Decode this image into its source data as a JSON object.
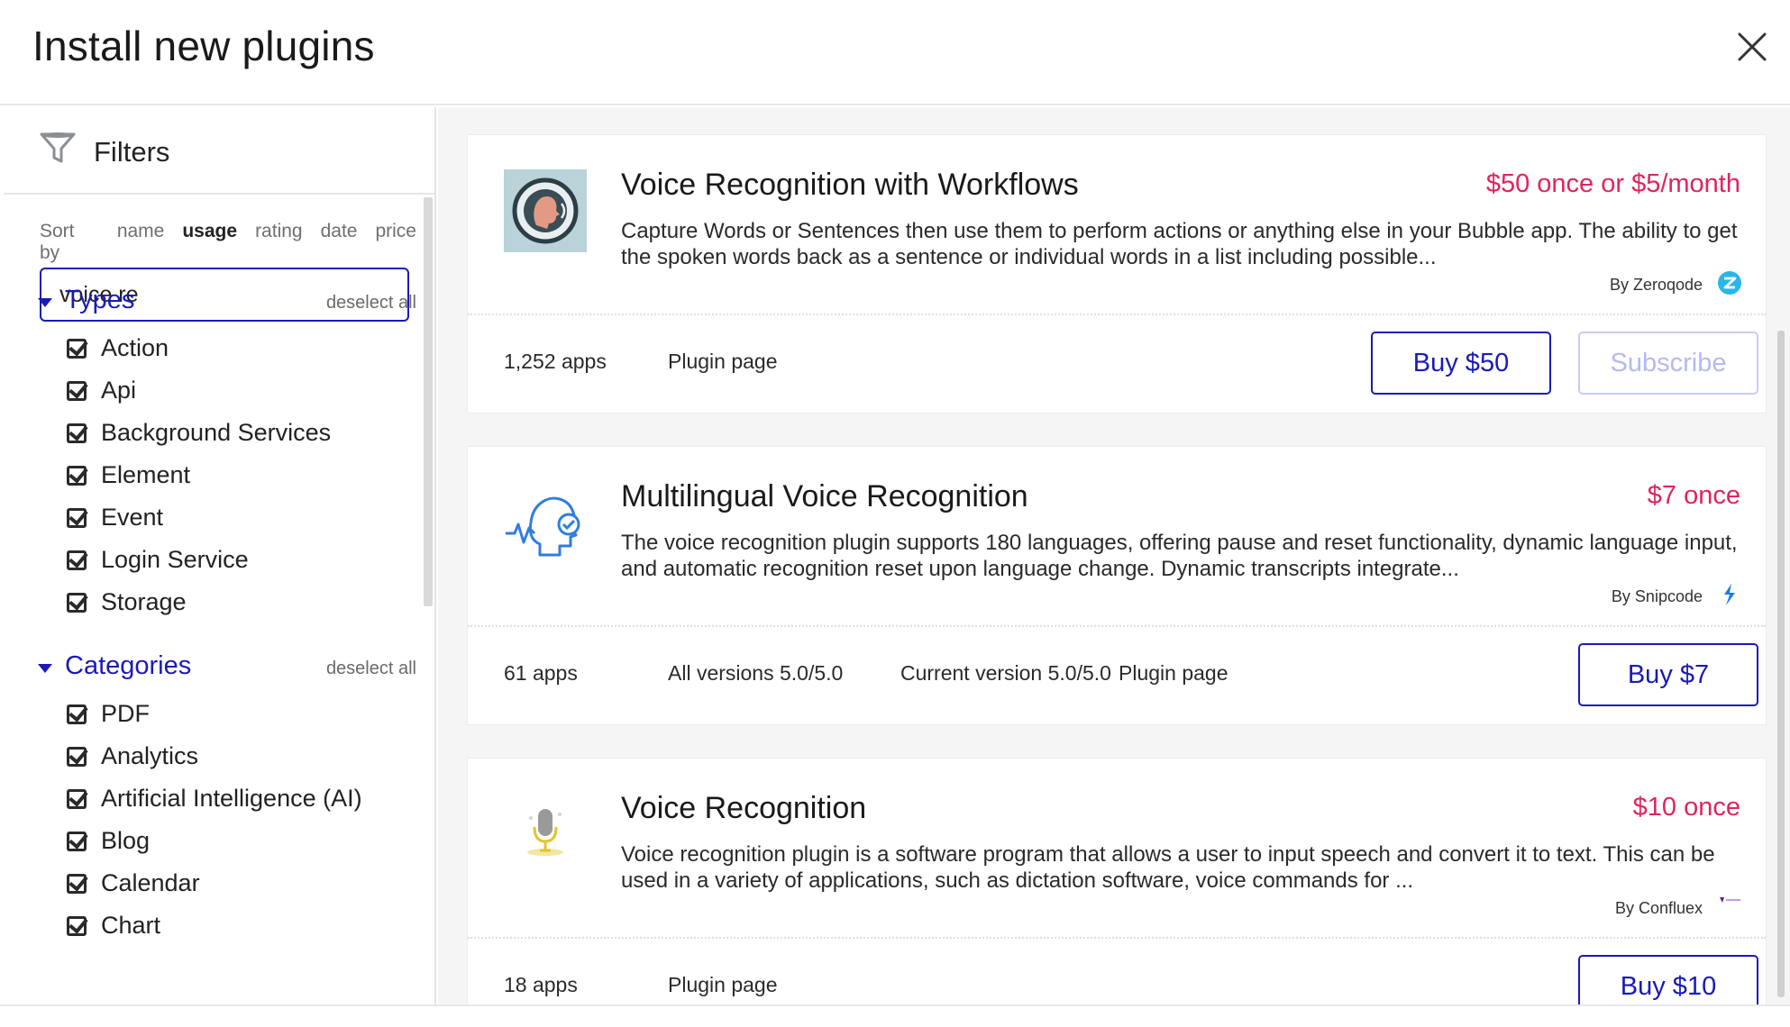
{
  "header": {
    "title": "Install new plugins",
    "close_icon": "close-icon"
  },
  "sidebar": {
    "filters_label": "Filters",
    "sort": {
      "label": "Sort by",
      "options": [
        "name",
        "usage",
        "rating",
        "date",
        "price"
      ],
      "active": "usage"
    },
    "search": {
      "value": "voice re"
    },
    "types": {
      "title": "Types",
      "deselect": "deselect all",
      "items": [
        "Action",
        "Api",
        "Background Services",
        "Element",
        "Event",
        "Login Service",
        "Storage"
      ]
    },
    "categories": {
      "title": "Categories",
      "deselect": "deselect all",
      "items": [
        "PDF",
        "Analytics",
        "Artificial Intelligence (AI)",
        "Blog",
        "Calendar",
        "Chart"
      ]
    }
  },
  "plugins": [
    {
      "title": "Voice Recognition with Workflows",
      "price": "$50 once or $5/month",
      "description": "Capture Words or Sentences then use them to perform actions or anything else in your Bubble app. The ability to get the spoken words back as a sentence or individual words in a list including possible...",
      "author": "By Zeroqode",
      "apps": "1,252 apps",
      "plugin_page": "Plugin page",
      "buy": "Buy $50",
      "subscribe": "Subscribe"
    },
    {
      "title": "Multilingual Voice Recognition",
      "price": "$7 once",
      "description": "The voice recognition plugin supports 180 languages, offering pause and reset functionality, dynamic language input, and automatic recognition reset upon language change. Dynamic transcripts integrate...",
      "author": "By Snipcode",
      "apps": "61 apps",
      "all_versions": "All versions 5.0/5.0",
      "current_version": "Current version 5.0/5.0",
      "plugin_page": "Plugin page",
      "buy": "Buy $7"
    },
    {
      "title": "Voice Recognition",
      "price": "$10 once",
      "description": "Voice recognition plugin is a software program that allows a user to input speech and convert it to text. This can be used in a variety of applications, such as dictation software, voice commands for ...",
      "author": "By Confluex",
      "apps": "18 apps",
      "plugin_page": "Plugin page",
      "buy": "Buy $10"
    }
  ],
  "colors": {
    "accent": "#1a1ab8",
    "price": "#e0245e",
    "disabled": "#b5b9ee"
  }
}
